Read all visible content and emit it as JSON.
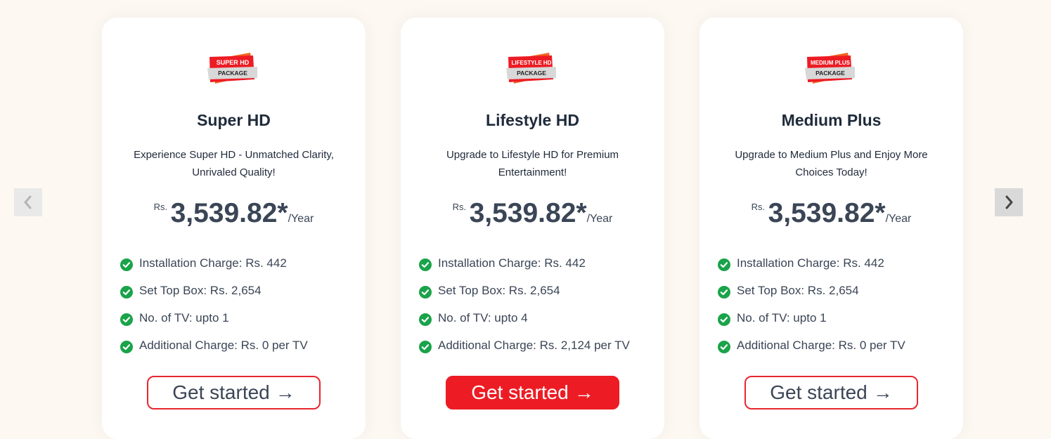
{
  "carousel": {
    "prev_icon": "chevron-left-icon",
    "next_icon": "chevron-right-icon"
  },
  "colors": {
    "accent": "#ed1c24",
    "check": "#1aa34a",
    "text": "#1f2a3a",
    "background": "#fdf8f2"
  },
  "plans": [
    {
      "logo_line1": "SUPER HD",
      "logo_line2": "PACKAGE",
      "name": "Super HD",
      "description": "Experience Super HD - Unmatched Clarity, Unrivaled Quality!",
      "currency": "Rs.",
      "price": "3,539.82*",
      "period": "/Year",
      "features": [
        "Installation Charge: Rs. 442",
        "Set Top Box: Rs. 2,654",
        "No. of TV: upto 1",
        "Additional Charge: Rs. 0 per TV"
      ],
      "button_label": "Get started",
      "button_arrow": "→"
    },
    {
      "logo_line1": "LIFESTYLE HD",
      "logo_line2": "PACKAGE",
      "name": "Lifestyle HD",
      "description": "Upgrade to Lifestyle HD for Premium Entertainment!",
      "currency": "Rs.",
      "price": "3,539.82*",
      "period": "/Year",
      "features": [
        "Installation Charge: Rs. 442",
        "Set Top Box: Rs. 2,654",
        "No. of TV: upto 4",
        "Additional Charge: Rs. 2,124 per TV"
      ],
      "button_label": "Get started",
      "button_arrow": "→"
    },
    {
      "logo_line1": "MEDIUM PLUS",
      "logo_line2": "PACKAGE",
      "name": "Medium Plus",
      "description": "Upgrade to Medium Plus and Enjoy More Choices Today!",
      "currency": "Rs.",
      "price": "3,539.82*",
      "period": "/Year",
      "features": [
        "Installation Charge: Rs. 442",
        "Set Top Box: Rs. 2,654",
        "No. of TV: upto 1",
        "Additional Charge: Rs. 0 per TV"
      ],
      "button_label": "Get started",
      "button_arrow": "→"
    }
  ]
}
